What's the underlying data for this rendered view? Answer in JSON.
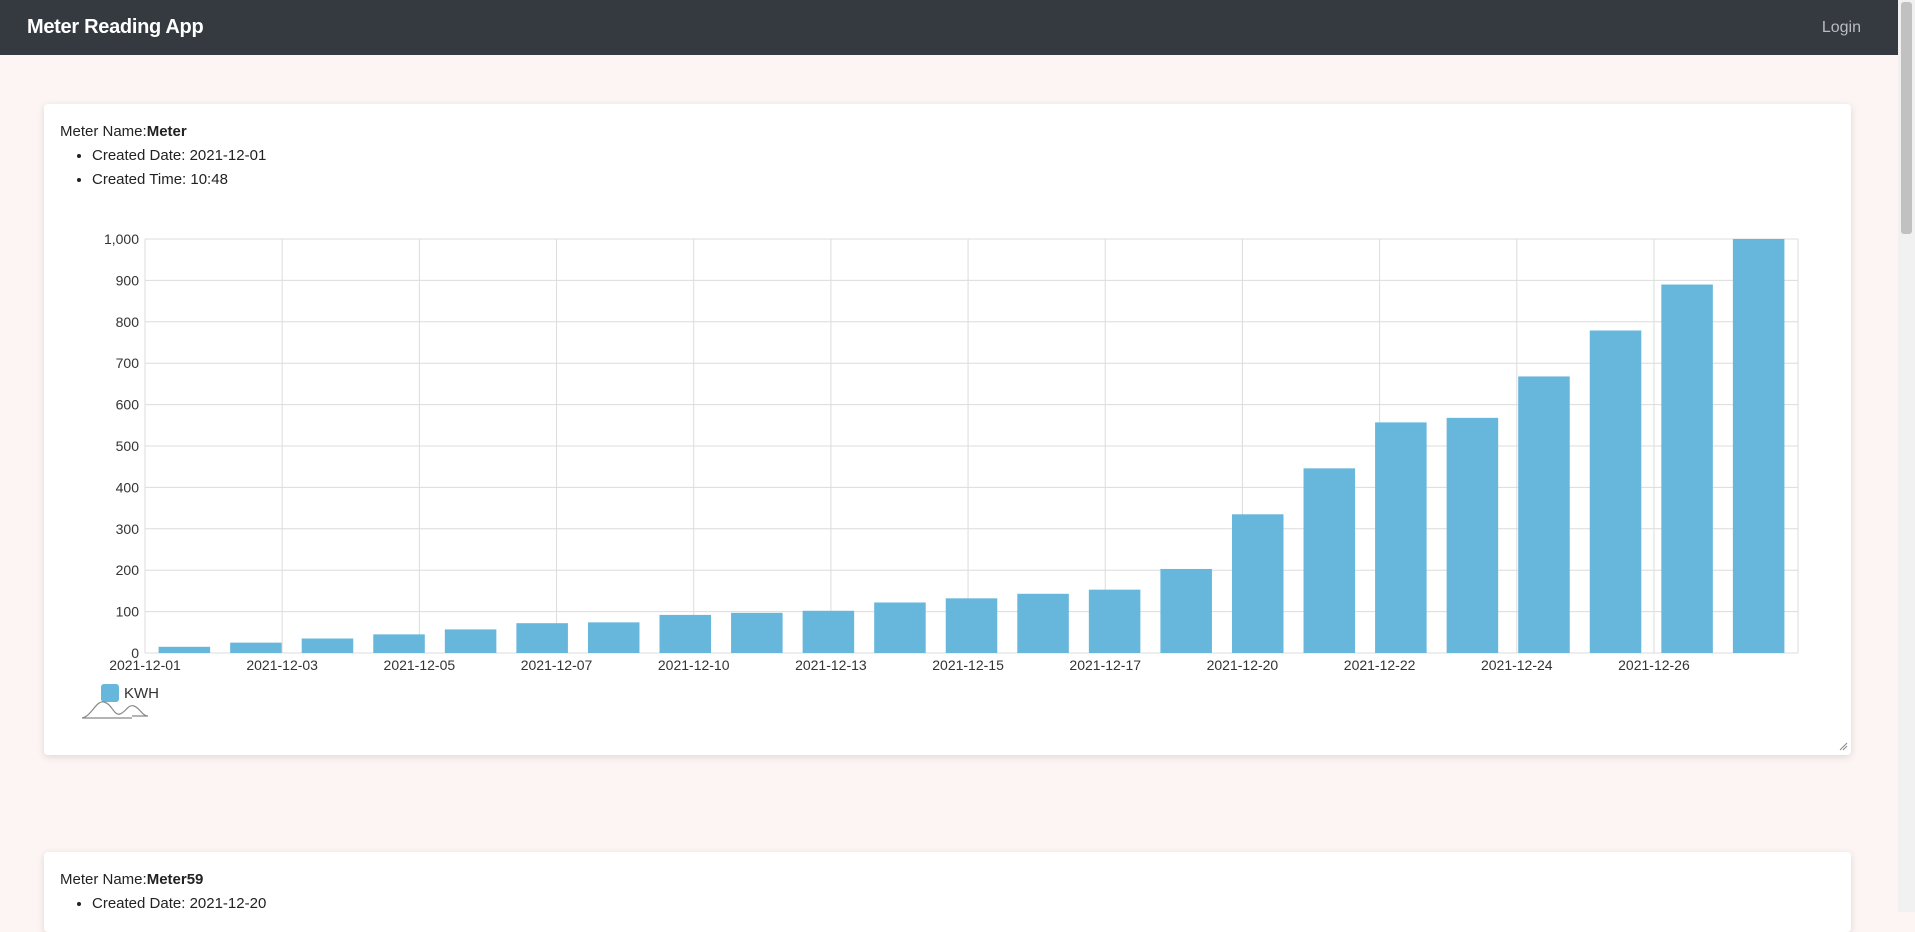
{
  "header": {
    "brand": "Meter Reading App",
    "login_label": "Login"
  },
  "meters": [
    {
      "name_label": "Meter Name:",
      "name": "Meter",
      "created_date_label": "Created Date: ",
      "created_date": "2021-12-01",
      "created_time_label": "Created Time: ",
      "created_time": "10:48"
    },
    {
      "name_label": "Meter Name:",
      "name": "Meter59",
      "created_date_label": "Created Date: ",
      "created_date": "2021-12-20"
    }
  ],
  "chart_data": {
    "type": "bar",
    "title": "",
    "xlabel": "",
    "ylabel": "",
    "ylim": [
      0,
      1000
    ],
    "y_ticks": [
      0,
      100,
      200,
      300,
      400,
      500,
      600,
      700,
      800,
      900,
      1000
    ],
    "y_tick_labels": [
      "0",
      "100",
      "200",
      "300",
      "400",
      "500",
      "600",
      "700",
      "800",
      "900",
      "1,000"
    ],
    "x_tick_labels": [
      "2021-12-01",
      "2021-12-03",
      "2021-12-05",
      "2021-12-07",
      "2021-12-10",
      "2021-12-13",
      "2021-12-15",
      "2021-12-17",
      "2021-12-20",
      "2021-12-22",
      "2021-12-24",
      "2021-12-26"
    ],
    "grid": true,
    "legend_position": "bottom-left",
    "series": [
      {
        "name": "KWH",
        "color": "#67b6db",
        "values": [
          15,
          25,
          35,
          45,
          57,
          72,
          74,
          92,
          97,
          102,
          122,
          132,
          143,
          153,
          203,
          335,
          446,
          557,
          568,
          668,
          779,
          890,
          1000
        ]
      }
    ]
  }
}
